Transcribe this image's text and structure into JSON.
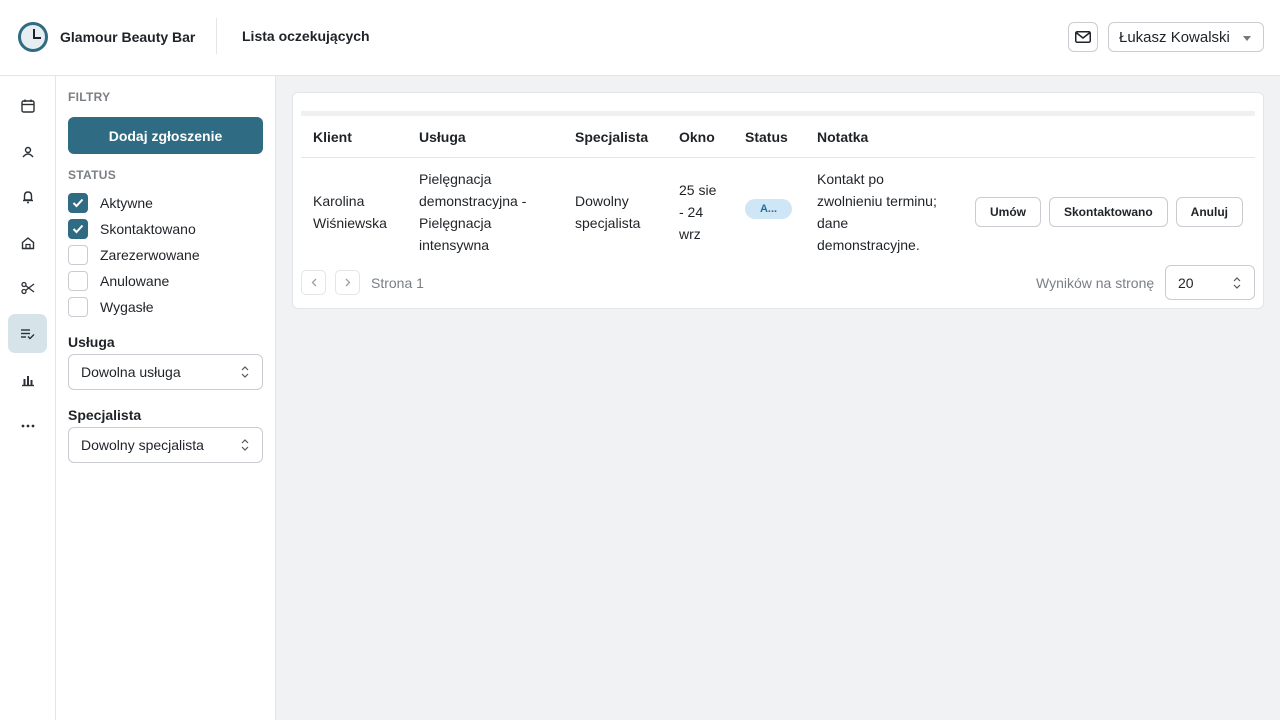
{
  "header": {
    "brand": "Glamour Beauty Bar",
    "page_title": "Lista oczekujących",
    "user_name": "Łukasz Kowalski"
  },
  "rail": {
    "items": [
      "calendar-icon",
      "client-icon",
      "bell-icon",
      "home-icon",
      "scissors-icon",
      "waitlist-icon",
      "chart-icon",
      "more-icon"
    ],
    "active": "waitlist-icon"
  },
  "filters": {
    "title": "FILTRY",
    "add_button": "Dodaj zgłoszenie",
    "status_title": "STATUS",
    "statuses": [
      {
        "label": "Aktywne",
        "checked": true
      },
      {
        "label": "Skontaktowano",
        "checked": true
      },
      {
        "label": "Zarezerwowane",
        "checked": false
      },
      {
        "label": "Anulowane",
        "checked": false
      },
      {
        "label": "Wygasłe",
        "checked": false
      }
    ],
    "service_label": "Usługa",
    "service_value": "Dowolna usługa",
    "specialist_label": "Specjalista",
    "specialist_value": "Dowolny specjalista"
  },
  "table": {
    "columns": [
      "Klient",
      "Usługa",
      "Specjalista",
      "Okno",
      "Status",
      "Notatka"
    ],
    "rows": [
      {
        "client": "Karolina Wiśniewska",
        "service": "Pielęgnacja demonstracyjna - Pielęgnacja intensywna",
        "specialist": "Dowolny specjalista",
        "window": "25 sie - 24 wrz",
        "status": "A...",
        "note": "Kontakt po zwolnieniu terminu; dane demonstracyjne.",
        "actions": [
          "Umów",
          "Skontaktowano",
          "Anuluj"
        ]
      }
    ]
  },
  "pagination": {
    "page_text": "Strona 1",
    "per_page_label": "Wyników na stronę",
    "per_page_value": "20"
  },
  "colors": {
    "accent": "#2f6b82",
    "status_pill_bg": "#cfe6f7",
    "background": "#f1f2f4"
  }
}
